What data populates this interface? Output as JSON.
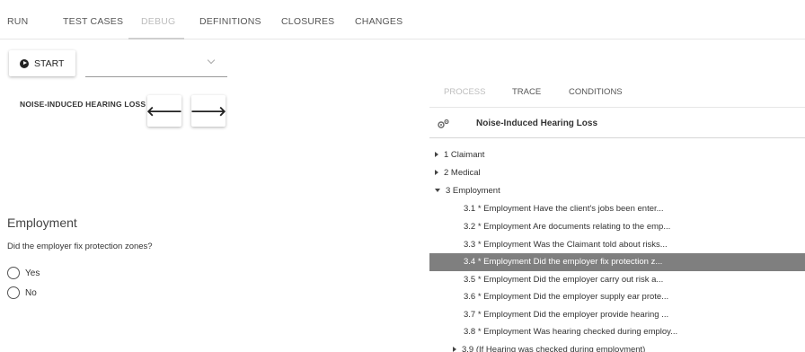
{
  "topnav": {
    "tabs": [
      {
        "label": "RUN"
      },
      {
        "label": "TEST CASES"
      },
      {
        "label": "DEBUG"
      },
      {
        "label": "DEFINITIONS"
      },
      {
        "label": "CLOSURES"
      },
      {
        "label": "CHANGES"
      }
    ]
  },
  "toolbar": {
    "start_label": "START",
    "select_value": ""
  },
  "section": {
    "title": "NOISE-INDUCED HEARING LOSS",
    "prev_label": "🡐",
    "next_label": "🡒"
  },
  "form": {
    "heading": "Employment",
    "question": "Did the employer fix protection zones?",
    "options": [
      {
        "label": "Yes"
      },
      {
        "label": "No"
      }
    ]
  },
  "right_panel": {
    "tabs": [
      {
        "label": "PROCESS"
      },
      {
        "label": "TRACE"
      },
      {
        "label": "CONDITIONS"
      }
    ],
    "process_title": "Noise-Induced Hearing Loss",
    "tree": [
      {
        "label": "1 Claimant"
      },
      {
        "label": "2 Medical"
      },
      {
        "label": "3 Employment"
      }
    ],
    "employment_items": [
      {
        "label": "3.1 * Employment Have the client's jobs been enter..."
      },
      {
        "label": "3.2 * Employment Are documents relating to the emp..."
      },
      {
        "label": "3.3 * Employment Was the Claimant told about risks..."
      },
      {
        "label": "3.4 * Employment Did the employer fix protection z..."
      },
      {
        "label": "3.5 * Employment Did the employer carry out risk a..."
      },
      {
        "label": "3.6 * Employment Did the employer supply ear prote..."
      },
      {
        "label": "3.7 * Employment Did the employer provide hearing ..."
      },
      {
        "label": "3.8 * Employment Was hearing checked during employ..."
      }
    ],
    "next_group": {
      "label": "3.9 (If Hearing was checked during employment)"
    }
  },
  "colors": {
    "selected_row": "#7f7f7f",
    "disabled_tab": "#bdbdbd"
  }
}
